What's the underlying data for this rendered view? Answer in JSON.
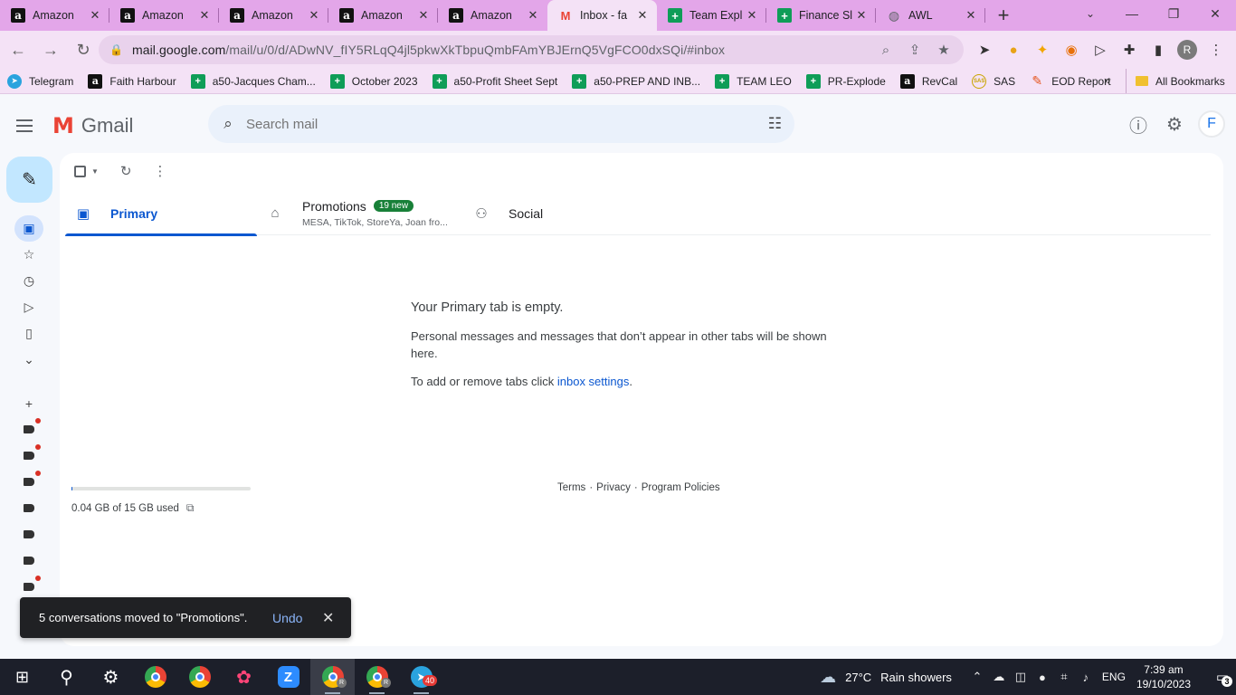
{
  "browser": {
    "tabs": [
      {
        "title": "Amazon",
        "icon": "amazon-icon"
      },
      {
        "title": "Amazon",
        "icon": "amazon-icon"
      },
      {
        "title": "Amazon",
        "icon": "amazon-icon"
      },
      {
        "title": "Amazon",
        "icon": "amazon-icon"
      },
      {
        "title": "Amazon",
        "icon": "amazon-icon"
      },
      {
        "title": "Inbox - fa",
        "icon": "gmail-icon",
        "active": true
      },
      {
        "title": "Team Expl",
        "icon": "sheets-icon"
      },
      {
        "title": "Finance Sl",
        "icon": "sheets-icon"
      },
      {
        "title": "AWL",
        "icon": "globe-icon"
      }
    ],
    "url_host": "mail.google.com",
    "url_path": "/mail/u/0/d/ADwNV_fIY5RLqQ4jl5pkwXkTbpuQmbFAmYBJErnQ5VgFCO0dxSQi/#inbox",
    "profile_initial": "R",
    "bookmarks": [
      {
        "label": "Telegram",
        "icon": "tg"
      },
      {
        "label": "Faith Harbour",
        "icon": "amz"
      },
      {
        "label": "a50-Jacques Cham...",
        "icon": "sheet"
      },
      {
        "label": "October 2023",
        "icon": "sheet"
      },
      {
        "label": "a50-Profit Sheet Sept",
        "icon": "sheet"
      },
      {
        "label": "a50-PREP AND INB...",
        "icon": "sheet"
      },
      {
        "label": "TEAM LEO",
        "icon": "sheet"
      },
      {
        "label": "PR-Explode",
        "icon": "sheet"
      },
      {
        "label": "RevCal",
        "icon": "amz"
      },
      {
        "label": "SAS",
        "icon": "sas"
      },
      {
        "label": "EOD Report",
        "icon": "eod"
      }
    ],
    "more_bookmarks": "»",
    "all_bookmarks": "All Bookmarks",
    "colors": {
      "frame": "#e3a6e9",
      "toolbar": "#f4e2f6"
    }
  },
  "gmail": {
    "logo_text": "Gmail",
    "search_placeholder": "Search mail",
    "avatar_initial": "F",
    "tabs": {
      "primary": "Primary",
      "promotions": "Promotions",
      "promotions_badge": "19 new",
      "promotions_senders": "MESA, TikTok, StoreYa, Joan fro...",
      "social": "Social"
    },
    "empty_title": "Your Primary tab is empty.",
    "empty_desc": "Personal messages and messages that don’t appear in other tabs will be shown here.",
    "empty_settings_prefix": "To add or remove tabs click ",
    "empty_settings_link": "inbox settings",
    "empty_settings_suffix": ".",
    "storage_used_text": "0.04 GB of 15 GB used",
    "storage_fraction": 0.0027,
    "footer": {
      "terms": "Terms",
      "privacy": "Privacy",
      "policies": "Program Policies",
      "dot": "·"
    },
    "snackbar": {
      "message": "5 conversations moved to \"Promotions\".",
      "action": "Undo"
    }
  },
  "taskbar": {
    "weather_temp": "27°C",
    "weather_text": "Rain showers",
    "weather_badge": "1",
    "telegram_badge": "40",
    "lang": "ENG",
    "time": "7:39 am",
    "date": "19/10/2023",
    "notifications": "3"
  }
}
